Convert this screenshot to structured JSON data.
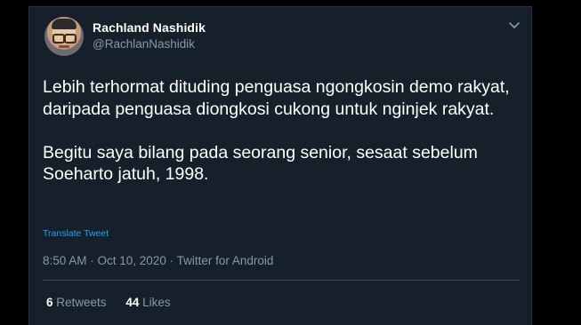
{
  "tweet": {
    "author_name": "Rachland Nashidik",
    "author_handle": "@RachlanNashidik",
    "text": "Lebih terhormat dituding penguasa ngongkosin demo rakyat, daripada penguasa diongkosi cukong untuk nginjek rakyat.\n\nBegitu saya bilang pada seorang senior, sesaat sebelum Soeharto jatuh, 1998.",
    "translate_label": "Translate Tweet",
    "meta": "8:50 AM · Oct 10, 2020 · Twitter for Android",
    "retweets_count": "6",
    "retweets_label": "Retweets",
    "likes_count": "44",
    "likes_label": "Likes"
  },
  "colors": {
    "background": "#15202b",
    "primary_text": "#ffffff",
    "secondary_text": "#8899a6",
    "link": "#1da1f2",
    "divider": "#38444d"
  },
  "icons": {
    "more": "chevron-down-icon",
    "avatar": "avatar"
  }
}
